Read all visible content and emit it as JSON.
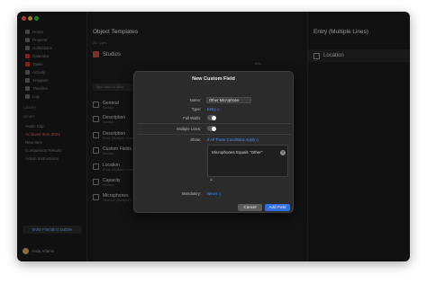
{
  "colors": {
    "accent": "#2f6fe0",
    "link": "#4a90ff",
    "window_bg": "#1f1f1f",
    "modal_bg": "#2b2b2b"
  },
  "sidebar": {
    "items": [
      {
        "label": "Home",
        "icon": "house-icon"
      },
      {
        "label": "Projects",
        "icon": "folder-icon"
      },
      {
        "label": "Collections",
        "icon": "stack-icon"
      },
      {
        "label": "Calendar",
        "icon": "calendar-icon"
      },
      {
        "label": "Tasks",
        "icon": "checklist-icon"
      },
      {
        "label": "Activity",
        "icon": "pulse-icon"
      },
      {
        "label": "Snippets",
        "icon": "snippet-icon"
      },
      {
        "label": "Timeline",
        "icon": "timeline-icon"
      },
      {
        "label": "Log",
        "icon": "log-icon"
      }
    ],
    "section_library": "Library",
    "section_smart": "Smart",
    "smart_items": [
      "Audio Clip",
      "Archived Item 2024",
      "New Item",
      "Comparison Results",
      "Action Instructions"
    ],
    "footer_button": "Invite Friends to Dabble",
    "user_name": "Andy Adams"
  },
  "middle": {
    "title": "Object Templates",
    "subtitle": "All Types",
    "studios_label": "Studios",
    "info_label": "Info",
    "type_filter_placeholder": "Type here to filter",
    "fields": [
      {
        "name": "General",
        "sub": "Section"
      },
      {
        "name": "Description",
        "sub": "Section"
      },
      {
        "name": "Description",
        "sub": "Entry (Multiple Lines)"
      },
      {
        "name": "Custom Fields",
        "sub": "Section"
      },
      {
        "name": "Location",
        "sub": "Entry (Multiple Lines)"
      },
      {
        "name": "Capacity",
        "sub": "Section"
      },
      {
        "name": "Microphones",
        "sub": "Selector (Multiple)"
      }
    ]
  },
  "right": {
    "title": "Entry (Multiple Lines)",
    "selected": "Location"
  },
  "modal": {
    "title": "New Custom Field",
    "name_label": "Name:",
    "name_value": "Other Microphone",
    "type_label": "Type:",
    "type_value": "Entry ◇",
    "full_width_label": "Full Width:",
    "multiple_lines_label": "Multiple Lines:",
    "show_label": "Show:",
    "show_value": "If All These Conditions Apply ◇",
    "condition": "Microphones Equals \"Other\"",
    "add_condition": "+",
    "mandatory_label": "Mandatory:",
    "mandatory_value": "Never ◇",
    "cancel": "Cancel",
    "add": "Add Field"
  }
}
